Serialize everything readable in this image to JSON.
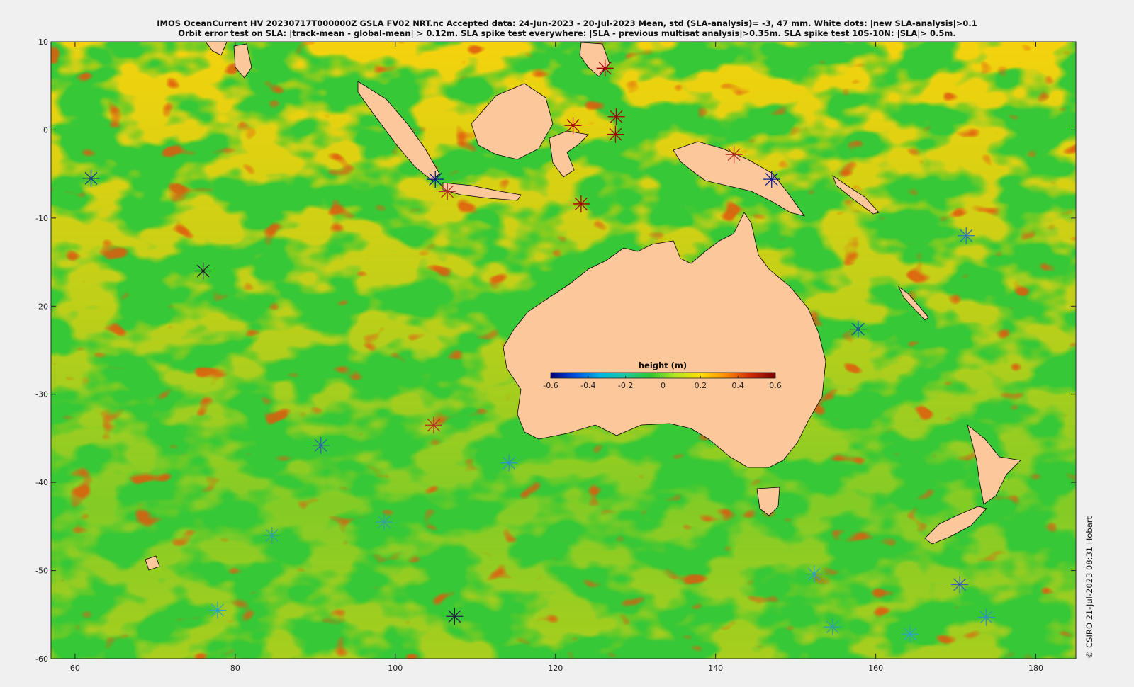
{
  "figure": {
    "title_line1": "IMOS OceanCurrent HV 20230717T000000Z GSLA FV02 NRT.nc  Accepted data: 24-Jun-2023 - 20-Jul-2023 Mean, std (SLA-analysis)= -3, 47 mm. White dots: |new SLA-analysis|>0.1",
    "title_line2": "Orbit error test on SLA: |track-mean  - global-mean| > 0.12m.  SLA spike test everywhere: |SLA - previous multisat analysis|>0.35m. SLA spike test 10S-10N: |SLA|> 0.5m.",
    "credit": "© CSIRO 21-Jul-2023 08:31 Hobart"
  },
  "map": {
    "lon_range": [
      57,
      185
    ],
    "lat_range": [
      -60,
      10
    ],
    "x_ticks": [
      60,
      80,
      100,
      120,
      140,
      160,
      180
    ],
    "y_ticks": [
      10,
      0,
      -10,
      -20,
      -30,
      -40,
      -50,
      -60
    ],
    "land_color": "#fcc89b",
    "ocean_base_color": "#37c837"
  },
  "colorbar": {
    "title": "height (m)",
    "range": [
      -0.6,
      0.6
    ],
    "ticks": [
      "-0.6",
      "-0.4",
      "-0.2",
      "0",
      "0.2",
      "0.4",
      "0.6"
    ],
    "colors": [
      "#00007a",
      "#0050e0",
      "#00b4e6",
      "#20c8a0",
      "#2dc92d",
      "#b4e61e",
      "#ffe000",
      "#ff8c00",
      "#d22800",
      "#7a0000"
    ]
  },
  "markers": [
    {
      "lon": 62,
      "lat": -5.5,
      "color": "#1a3a8a"
    },
    {
      "lon": 76,
      "lat": -16,
      "color": "#222222"
    },
    {
      "lon": 90.7,
      "lat": -35.8,
      "color": "#3060b0"
    },
    {
      "lon": 104.8,
      "lat": -33.5,
      "color": "#b03020"
    },
    {
      "lon": 114.2,
      "lat": -37.8,
      "color": "#3090c0"
    },
    {
      "lon": 107.4,
      "lat": -55.2,
      "color": "#202040"
    },
    {
      "lon": 105,
      "lat": -5.6,
      "color": "#0a1a8a"
    },
    {
      "lon": 106.5,
      "lat": -7,
      "color": "#b03020"
    },
    {
      "lon": 142.3,
      "lat": -2.8,
      "color": "#b03020"
    },
    {
      "lon": 147,
      "lat": -5.6,
      "color": "#0a1a8a"
    },
    {
      "lon": 123.2,
      "lat": -8.4,
      "color": "#a00000"
    },
    {
      "lon": 122.2,
      "lat": 0.5,
      "color": "#a00000"
    },
    {
      "lon": 126.2,
      "lat": 7,
      "color": "#a00000"
    },
    {
      "lon": 127.6,
      "lat": 1.5,
      "color": "#a00000"
    },
    {
      "lon": 127.5,
      "lat": -0.5,
      "color": "#a00000"
    },
    {
      "lon": 157.8,
      "lat": -22.6,
      "color": "#1a4a9a"
    },
    {
      "lon": 171.3,
      "lat": -12,
      "color": "#3070c0"
    },
    {
      "lon": 170.5,
      "lat": -51.6,
      "color": "#3060b0"
    },
    {
      "lon": 173.8,
      "lat": -55.3,
      "color": "#3090c0"
    },
    {
      "lon": 164.3,
      "lat": -57.2,
      "color": "#30a0c0"
    },
    {
      "lon": 154.6,
      "lat": -56.4,
      "color": "#30a0a0"
    },
    {
      "lon": 152.3,
      "lat": -50.4,
      "color": "#30a0c0"
    },
    {
      "lon": 77.8,
      "lat": -54.5,
      "color": "#30a0c0"
    },
    {
      "lon": 84.6,
      "lat": -46,
      "color": "#30a0a0"
    },
    {
      "lon": 98.6,
      "lat": -44.5,
      "color": "#30a0a0"
    }
  ]
}
